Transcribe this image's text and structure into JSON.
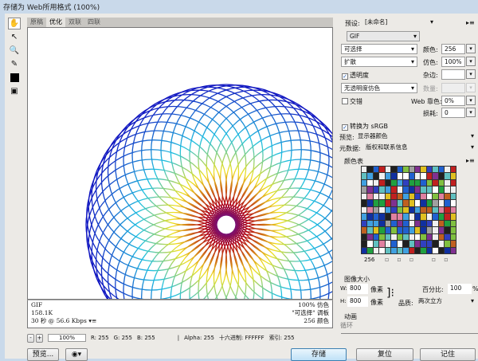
{
  "window": {
    "title": "存储为 Web所用格式 (100%)"
  },
  "tools": [
    "hand-icon",
    "slice-select-icon",
    "zoom-icon",
    "eyedropper-icon",
    "color-swatch-icon",
    "toggle-slices-icon"
  ],
  "tabs": [
    {
      "label": "原稿",
      "active": false
    },
    {
      "label": "优化",
      "active": true
    },
    {
      "label": "双联",
      "active": false
    },
    {
      "label": "四联",
      "active": false
    }
  ],
  "info": {
    "format": "GIF",
    "size": "158.1K",
    "time": "30 秒 @ 56.6 Kbps",
    "menu": "▾≡",
    "dither": "100% 仿色",
    "palette": "\"可选择\" 调板",
    "colors": "256 颜色"
  },
  "status": {
    "zoom": "100%",
    "r": "R: 255",
    "g": "G: 255",
    "b": "B: 255",
    "alpha": "Alpha: 255",
    "hex": "十六进制: FFFFFF",
    "index": "索引: 255"
  },
  "buttons": {
    "preview": "预览...",
    "save": "存储",
    "reset": "复位",
    "remember": "记住"
  },
  "settings": {
    "preset_label": "预设:",
    "preset": "[未命名]",
    "format": "GIF",
    "reduction": "可选择",
    "dither_algo": "扩散",
    "colors_label": "颜色:",
    "colors": "256",
    "dither_label": "仿色:",
    "dither": "100%",
    "transparency": "透明度",
    "transparency_checked": true,
    "matte_label": "杂边:",
    "matte": "",
    "trans_dither": "无透明度仿色",
    "amount_label": "数量:",
    "amount": "",
    "interlaced": "交错",
    "interlaced_checked": false,
    "web_label": "Web 靠色:",
    "web": "0%",
    "lossy_label": "损耗:",
    "lossy": "0",
    "srgb": "转换为 sRGB",
    "srgb_checked": true,
    "preview_label": "预览:",
    "preview": "显示器颜色",
    "metadata_label": "元数据:",
    "metadata": "版权和联系信息"
  },
  "color_table": {
    "title": "颜色表",
    "count": "256"
  },
  "image_size": {
    "title": "图像大小",
    "w_label": "W:",
    "w": "800",
    "h_label": "H:",
    "h": "800",
    "unit": "像素",
    "percent_label": "百分比:",
    "percent": "100",
    "percent_unit": "%",
    "quality_label": "品质:",
    "quality": "两次立方"
  },
  "animation": {
    "title": "动画",
    "loop_label": "循环"
  },
  "colors": {
    "ring_center": "#5020c0",
    "ring_inner": "#b00010",
    "ring_mid": "#f0e020",
    "ring_outer": "#20c0e0",
    "ring_edge": "#1010c0",
    "accent": "#1a55b0"
  }
}
